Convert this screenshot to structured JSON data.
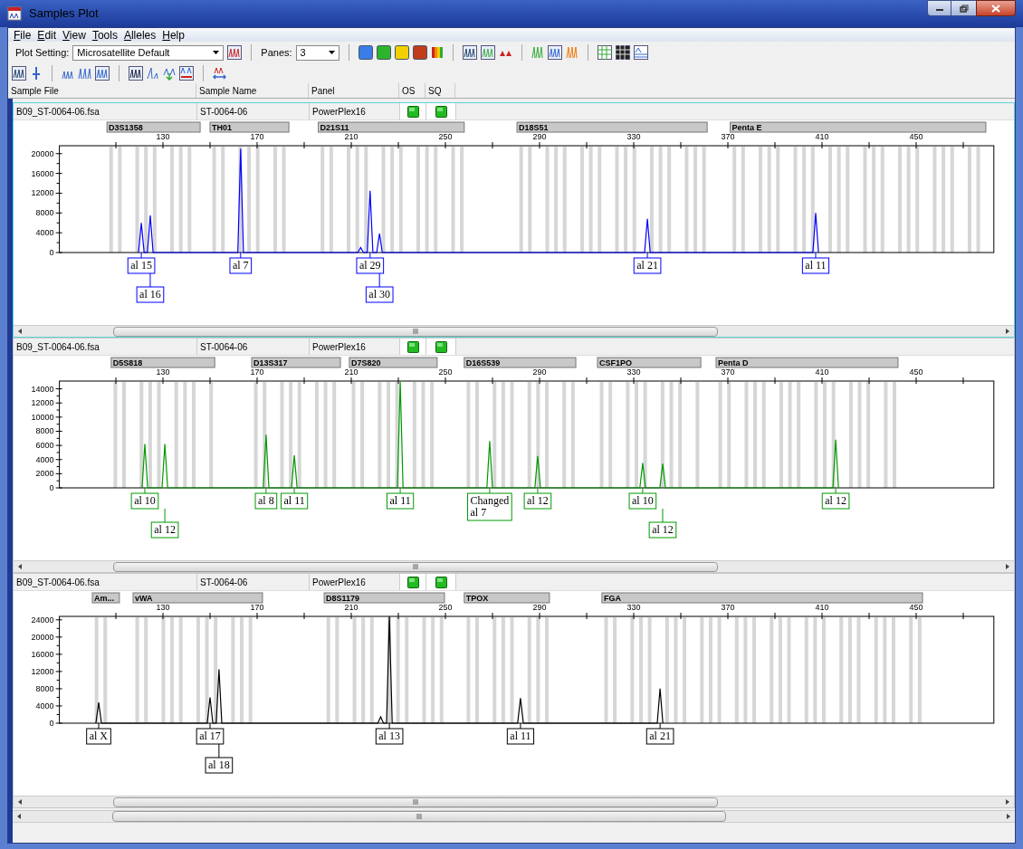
{
  "window": {
    "title": "Samples Plot"
  },
  "menu": [
    {
      "label": "File"
    },
    {
      "label": "Edit"
    },
    {
      "label": "View"
    },
    {
      "label": "Tools"
    },
    {
      "label": "Alleles"
    },
    {
      "label": "Help"
    }
  ],
  "toolbar": {
    "plot_setting_label": "Plot Setting:",
    "plot_setting": "Microsatellite Default",
    "panes_label": "Panes:",
    "panes": "3"
  },
  "columns": [
    "Sample File",
    "Sample Name",
    "Panel",
    "OS",
    "SQ"
  ],
  "panes": [
    {
      "selected": true,
      "sample_file": "B09_ST-0064-06.fsa",
      "sample_name": "ST-0064-06",
      "panel": "PowerPlex16",
      "loci": [
        "D3S1358",
        "TH01",
        "D21S11",
        "D18S51",
        "Penta E"
      ],
      "chart_data": {
        "type": "line",
        "xlim": [
          86,
          483
        ],
        "ylim": [
          0,
          21600
        ],
        "xticks": [
          130,
          170,
          210,
          250,
          290,
          330,
          370,
          410,
          450
        ],
        "yticks": [
          0,
          4000,
          8000,
          12000,
          16000,
          20000
        ],
        "x": [
          119.6,
          120.8,
          122,
          123.4,
          124.6,
          125.8,
          161.8,
          163,
          164.2,
          212.8,
          214,
          215.2,
          216.8,
          218,
          219.2,
          220.8,
          222,
          223.2,
          334.6,
          335.8,
          337,
          406.1,
          407.3,
          408.5
        ],
        "series": [
          {
            "color": "#0000ff",
            "values": [
              0,
              6000,
              0,
              0,
              7500,
              0,
              0,
              21000,
              0,
              0,
              1000,
              0,
              0,
              12500,
              0,
              0,
              3800,
              0,
              0,
              6800,
              0,
              0,
              8000,
              0
            ]
          }
        ],
        "annotations": [
          "al 15",
          "al 16",
          "al 7",
          "al 29",
          "al 30",
          "al 21",
          "al 11"
        ]
      }
    },
    {
      "selected": false,
      "sample_file": "B09_ST-0064-06.fsa",
      "sample_name": "ST-0064-06",
      "panel": "PowerPlex16",
      "loci": [
        "D5S818",
        "D13S317",
        "D7S820",
        "D16S539",
        "CSF1PO",
        "Penta D"
      ],
      "chart_data": {
        "type": "line",
        "xlim": [
          86,
          483
        ],
        "ylim": [
          0,
          15100
        ],
        "xticks": [
          130,
          170,
          210,
          250,
          290,
          330,
          370,
          410,
          450
        ],
        "yticks": [
          0,
          2000,
          4000,
          6000,
          8000,
          10000,
          12000,
          14000
        ],
        "x": [
          121.1,
          122.3,
          123.5,
          129.6,
          130.8,
          132,
          172.6,
          173.8,
          175,
          184.6,
          185.8,
          187,
          229.6,
          230.8,
          232,
          267.6,
          268.8,
          270,
          288,
          289.2,
          290.4,
          332.6,
          333.8,
          335,
          341.1,
          342.3,
          343.5,
          414.6,
          415.8,
          417
        ],
        "series": [
          {
            "color": "#009900",
            "values": [
              0,
              6200,
              0,
              0,
              6200,
              0,
              0,
              7500,
              0,
              0,
              4600,
              0,
              0,
              15000,
              0,
              0,
              6600,
              0,
              0,
              4500,
              0,
              0,
              3500,
              0,
              0,
              3400,
              0,
              0,
              6800,
              0
            ]
          }
        ],
        "annotations": [
          "al 10",
          "al 12",
          "al 8",
          "al 11",
          "al 11",
          "Changed al 7",
          "al 12",
          "al 10",
          "al 12",
          "al 12"
        ]
      }
    },
    {
      "selected": false,
      "sample_file": "B09_ST-0064-06.fsa",
      "sample_name": "ST-0064-06",
      "panel": "PowerPlex16",
      "loci": [
        "Am...",
        "vWA",
        "D8S1179",
        "TPOX",
        "FGA"
      ],
      "chart_data": {
        "type": "line",
        "xlim": [
          86,
          483
        ],
        "ylim": [
          0,
          24800
        ],
        "xticks": [
          130,
          170,
          210,
          250,
          290,
          330,
          370,
          410,
          450
        ],
        "yticks": [
          0,
          4000,
          8000,
          12000,
          16000,
          20000,
          24000
        ],
        "x": [
          101.5,
          102.7,
          103.9,
          148.8,
          150,
          151.2,
          152.6,
          153.8,
          155,
          221.3,
          222.5,
          223.7,
          225,
          226.2,
          227.4,
          280.7,
          281.9,
          283.1,
          340,
          341.2,
          342.4
        ],
        "series": [
          {
            "color": "#000000",
            "values": [
              0,
              4800,
              0,
              0,
              6000,
              0,
              0,
              12500,
              0,
              0,
              1500,
              0,
              0,
              24800,
              0,
              0,
              5800,
              0,
              0,
              8000,
              0
            ]
          }
        ],
        "annotations": [
          "al X",
          "al 17",
          "al 18",
          "al 13",
          "al 11",
          "al 21"
        ]
      }
    }
  ]
}
